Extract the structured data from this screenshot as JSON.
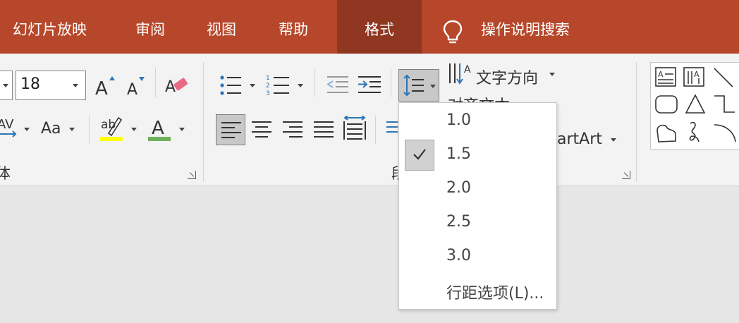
{
  "tabs": {
    "slideshow": "幻灯片放映",
    "review": "审阅",
    "view": "视图",
    "help": "帮助",
    "format": "格式",
    "search": "操作说明搜索"
  },
  "font_group": {
    "size_value": "18",
    "case_label": "Aa",
    "spacing_label": "AV",
    "group_label_partial": "体"
  },
  "paragraph_group": {
    "text_direction": "文字方向",
    "align_text_partial": "对齐文本",
    "smartart_partial": "artArt",
    "group_label_partial": "段"
  },
  "line_spacing_menu": {
    "options": [
      "1.0",
      "1.5",
      "2.0",
      "2.5",
      "3.0"
    ],
    "selected": "1.5",
    "more": "行距选项(L)..."
  },
  "colors": {
    "tab_bar": "#b7472a",
    "tab_active": "#8f3720",
    "highlight_color": "#ffff00",
    "font_color": "#6fb05a"
  }
}
